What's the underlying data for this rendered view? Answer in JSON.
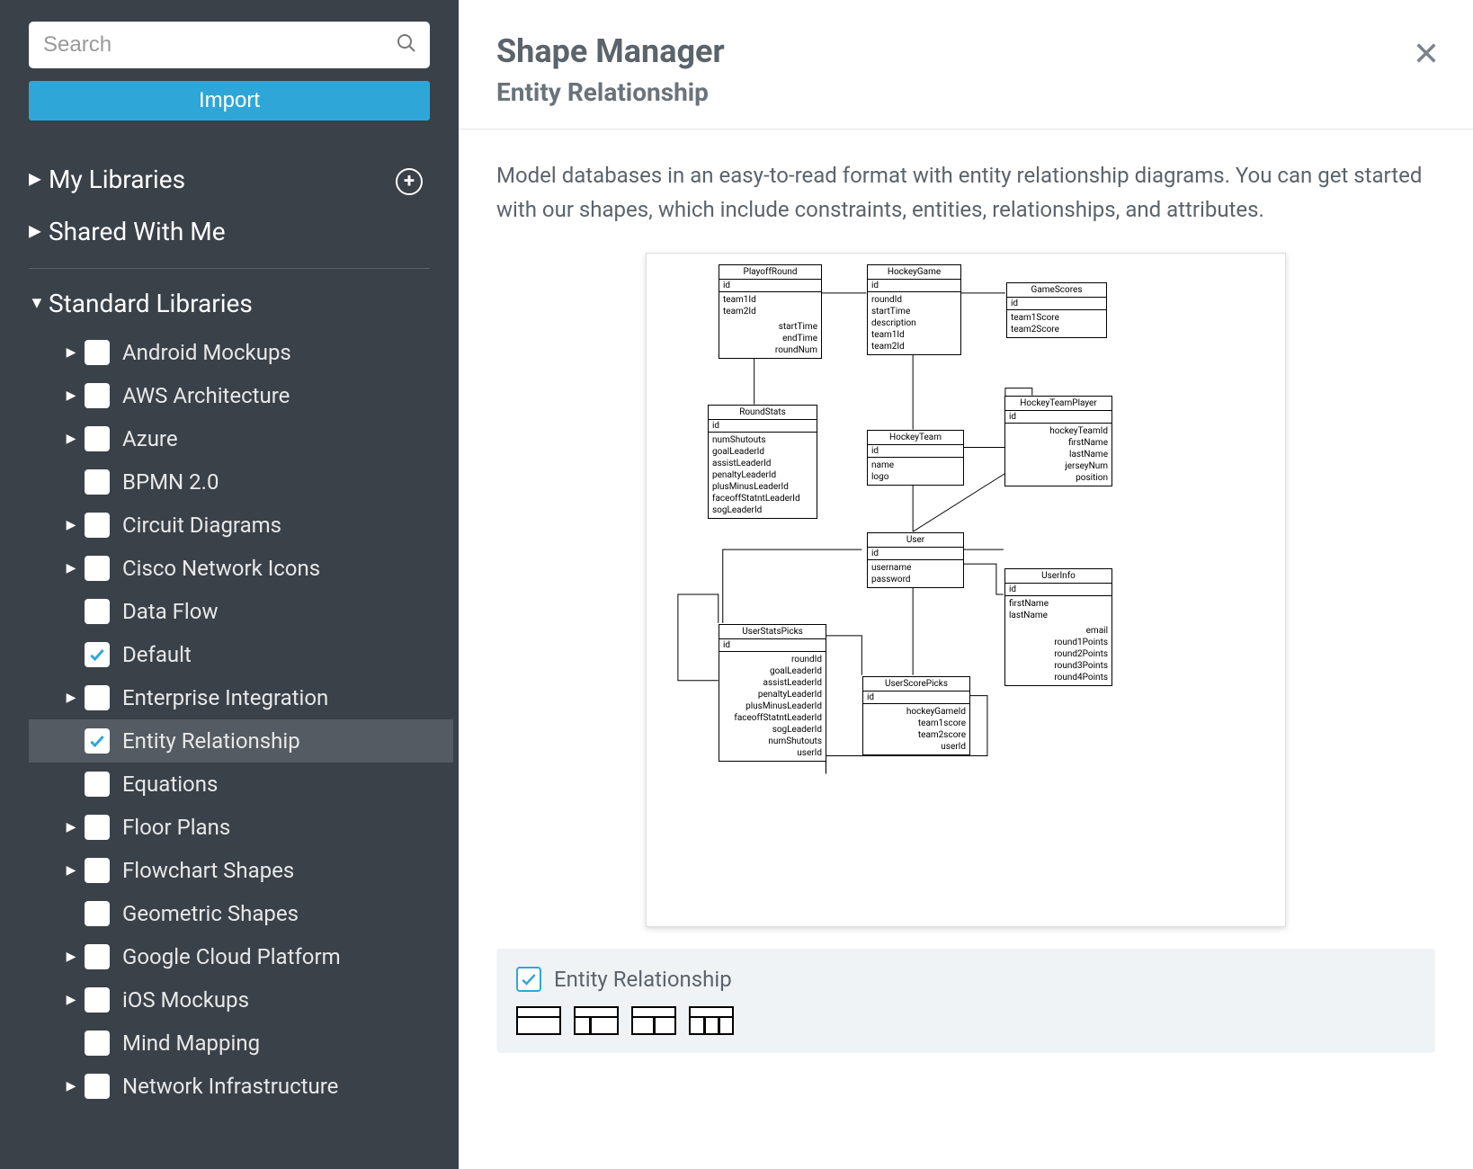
{
  "search": {
    "placeholder": "Search"
  },
  "import_label": "Import",
  "sections": {
    "my_libraries": "My Libraries",
    "shared_with_me": "Shared With Me",
    "standard_libraries": "Standard Libraries"
  },
  "libraries": [
    {
      "label": "Android Mockups",
      "caret": true,
      "checked": false
    },
    {
      "label": "AWS Architecture",
      "caret": true,
      "checked": false
    },
    {
      "label": "Azure",
      "caret": true,
      "checked": false
    },
    {
      "label": "BPMN 2.0",
      "caret": false,
      "checked": false
    },
    {
      "label": "Circuit Diagrams",
      "caret": true,
      "checked": false
    },
    {
      "label": "Cisco Network Icons",
      "caret": true,
      "checked": false
    },
    {
      "label": "Data Flow",
      "caret": false,
      "checked": false
    },
    {
      "label": "Default",
      "caret": false,
      "checked": true
    },
    {
      "label": "Enterprise Integration",
      "caret": true,
      "checked": false
    },
    {
      "label": "Entity Relationship",
      "caret": false,
      "checked": true,
      "selected": true
    },
    {
      "label": "Equations",
      "caret": false,
      "checked": false
    },
    {
      "label": "Floor Plans",
      "caret": true,
      "checked": false
    },
    {
      "label": "Flowchart Shapes",
      "caret": true,
      "checked": false
    },
    {
      "label": "Geometric Shapes",
      "caret": false,
      "checked": false
    },
    {
      "label": "Google Cloud Platform",
      "caret": true,
      "checked": false
    },
    {
      "label": "iOS Mockups",
      "caret": true,
      "checked": false
    },
    {
      "label": "Mind Mapping",
      "caret": false,
      "checked": false
    },
    {
      "label": "Network Infrastructure",
      "caret": true,
      "checked": false
    }
  ],
  "main": {
    "title": "Shape Manager",
    "subtitle": "Entity Relationship",
    "description": "Model databases in an easy-to-read format with entity relationship diagrams. You can get started with our shapes, which include constraints, entities, relationships, and attributes.",
    "footer_label": "Entity Relationship"
  },
  "diagram": {
    "entities": {
      "playoffRound": {
        "title": "PlayoffRound",
        "pk": "id",
        "rows": [
          "team1Id",
          "team2Id"
        ],
        "rows_right": [
          "startTime",
          "endTime",
          "roundNum"
        ]
      },
      "hockeyGame": {
        "title": "HockeyGame",
        "pk": "id",
        "rows": [
          "roundId",
          "startTime",
          "description",
          "team1Id",
          "team2Id"
        ]
      },
      "gameScores": {
        "title": "GameScores",
        "pk": "id",
        "rows": [
          "team1Score",
          "team2Score"
        ]
      },
      "roundStats": {
        "title": "RoundStats",
        "pk": "id",
        "rows": [
          "numShutouts",
          "goalLeaderId",
          "assistLeaderId",
          "penaltyLeaderId",
          "plusMinusLeaderId",
          "faceoffStatntLeaderId",
          "sogLeaderId"
        ]
      },
      "hockeyTeam": {
        "title": "HockeyTeam",
        "pk": "id",
        "rows": [
          "name",
          "logo"
        ]
      },
      "hockeyTeamPlayer": {
        "title": "HockeyTeamPlayer",
        "pk": "id",
        "rows": [
          "hockeyTeamId",
          "firstName",
          "lastName",
          "jerseyNum",
          "position"
        ]
      },
      "user": {
        "title": "User",
        "pk": "id",
        "rows": [
          "username",
          "password"
        ]
      },
      "userInfo": {
        "title": "UserInfo",
        "pk": "id",
        "rows": [
          "firstName",
          "lastName"
        ],
        "rows_right": [
          "email",
          "round1Points",
          "round2Points",
          "round3Points",
          "round4Points"
        ]
      },
      "userStatsPicks": {
        "title": "UserStatsPicks",
        "pk": "id",
        "rows": [
          "roundId",
          "goalLeaderId",
          "assistLeaderId",
          "penaltyLeaderId",
          "plusMinusLeaderId",
          "faceoffStatntLeaderId",
          "sogLeaderId",
          "numShutouts",
          "userId"
        ]
      },
      "userScorePicks": {
        "title": "UserScorePicks",
        "pk": "id",
        "rows": [
          "hockeyGameId",
          "team1score",
          "team2score",
          "userId"
        ]
      }
    }
  }
}
